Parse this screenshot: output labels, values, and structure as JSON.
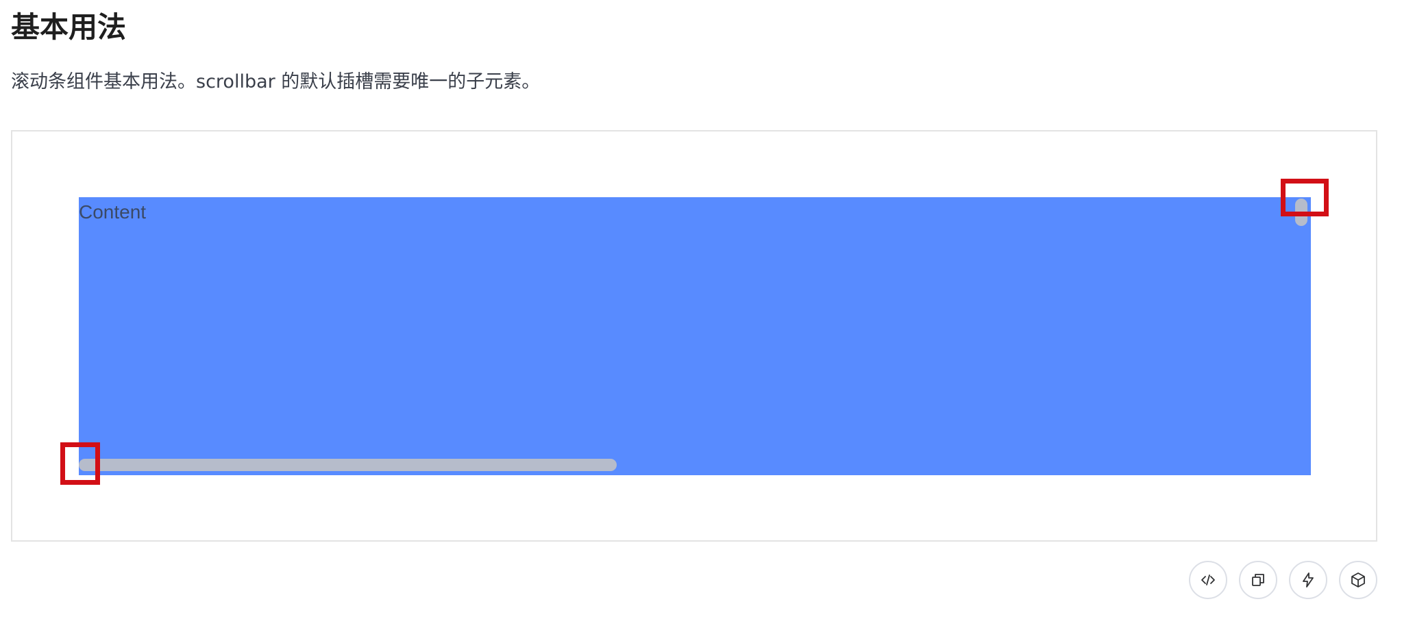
{
  "section": {
    "title": "基本用法",
    "description": "滚动条组件基本用法。scrollbar 的默认插槽需要唯一的子元素。"
  },
  "demo": {
    "content_label": "Content",
    "content_color": "#588bff",
    "thumb_color": "#b6bccb",
    "highlight_color": "#d20f16"
  },
  "toolbar": {
    "buttons": [
      {
        "icon": "code-icon"
      },
      {
        "icon": "copy-icon"
      },
      {
        "icon": "lightning-icon"
      },
      {
        "icon": "cube-icon"
      }
    ]
  }
}
